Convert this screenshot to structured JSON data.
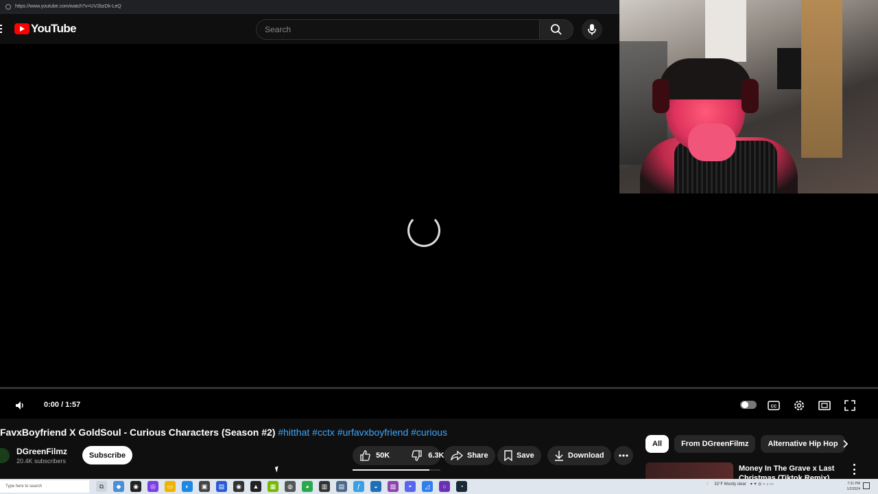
{
  "browser": {
    "url": "https://www.youtube.com/watch?v=UV2bzDk-LeQ"
  },
  "header": {
    "logo_text": "YouTube",
    "search_placeholder": "Search"
  },
  "player": {
    "time": "0:00 / 1:57",
    "progress_fraction": 0,
    "autoplay": "on"
  },
  "video": {
    "title": "FavxBoyfriend X GoldSoul - Curious Characters (Season #2)",
    "hashtags": [
      "#hitthat",
      "#cctx",
      "#urfavxboyfriend",
      "#curious"
    ],
    "channel_name": "DGreenFilmz",
    "subscribers": "20.4K subscribers",
    "subscribe_label": "Subscribe",
    "likes": "50K",
    "dislikes": "6.3K",
    "share_label": "Share",
    "save_label": "Save",
    "download_label": "Download"
  },
  "chips": [
    "All",
    "From DGreenFilmz",
    "Alternative Hip Hop"
  ],
  "recommendation": {
    "title": "Money In The Grave x Last Christmas (Tiktok Remix)"
  },
  "taskbar": {
    "search_placeholder": "Type here to search",
    "weather": "32°F  Mostly clear",
    "time": "7:31 PM",
    "date": "1/2/2024"
  }
}
